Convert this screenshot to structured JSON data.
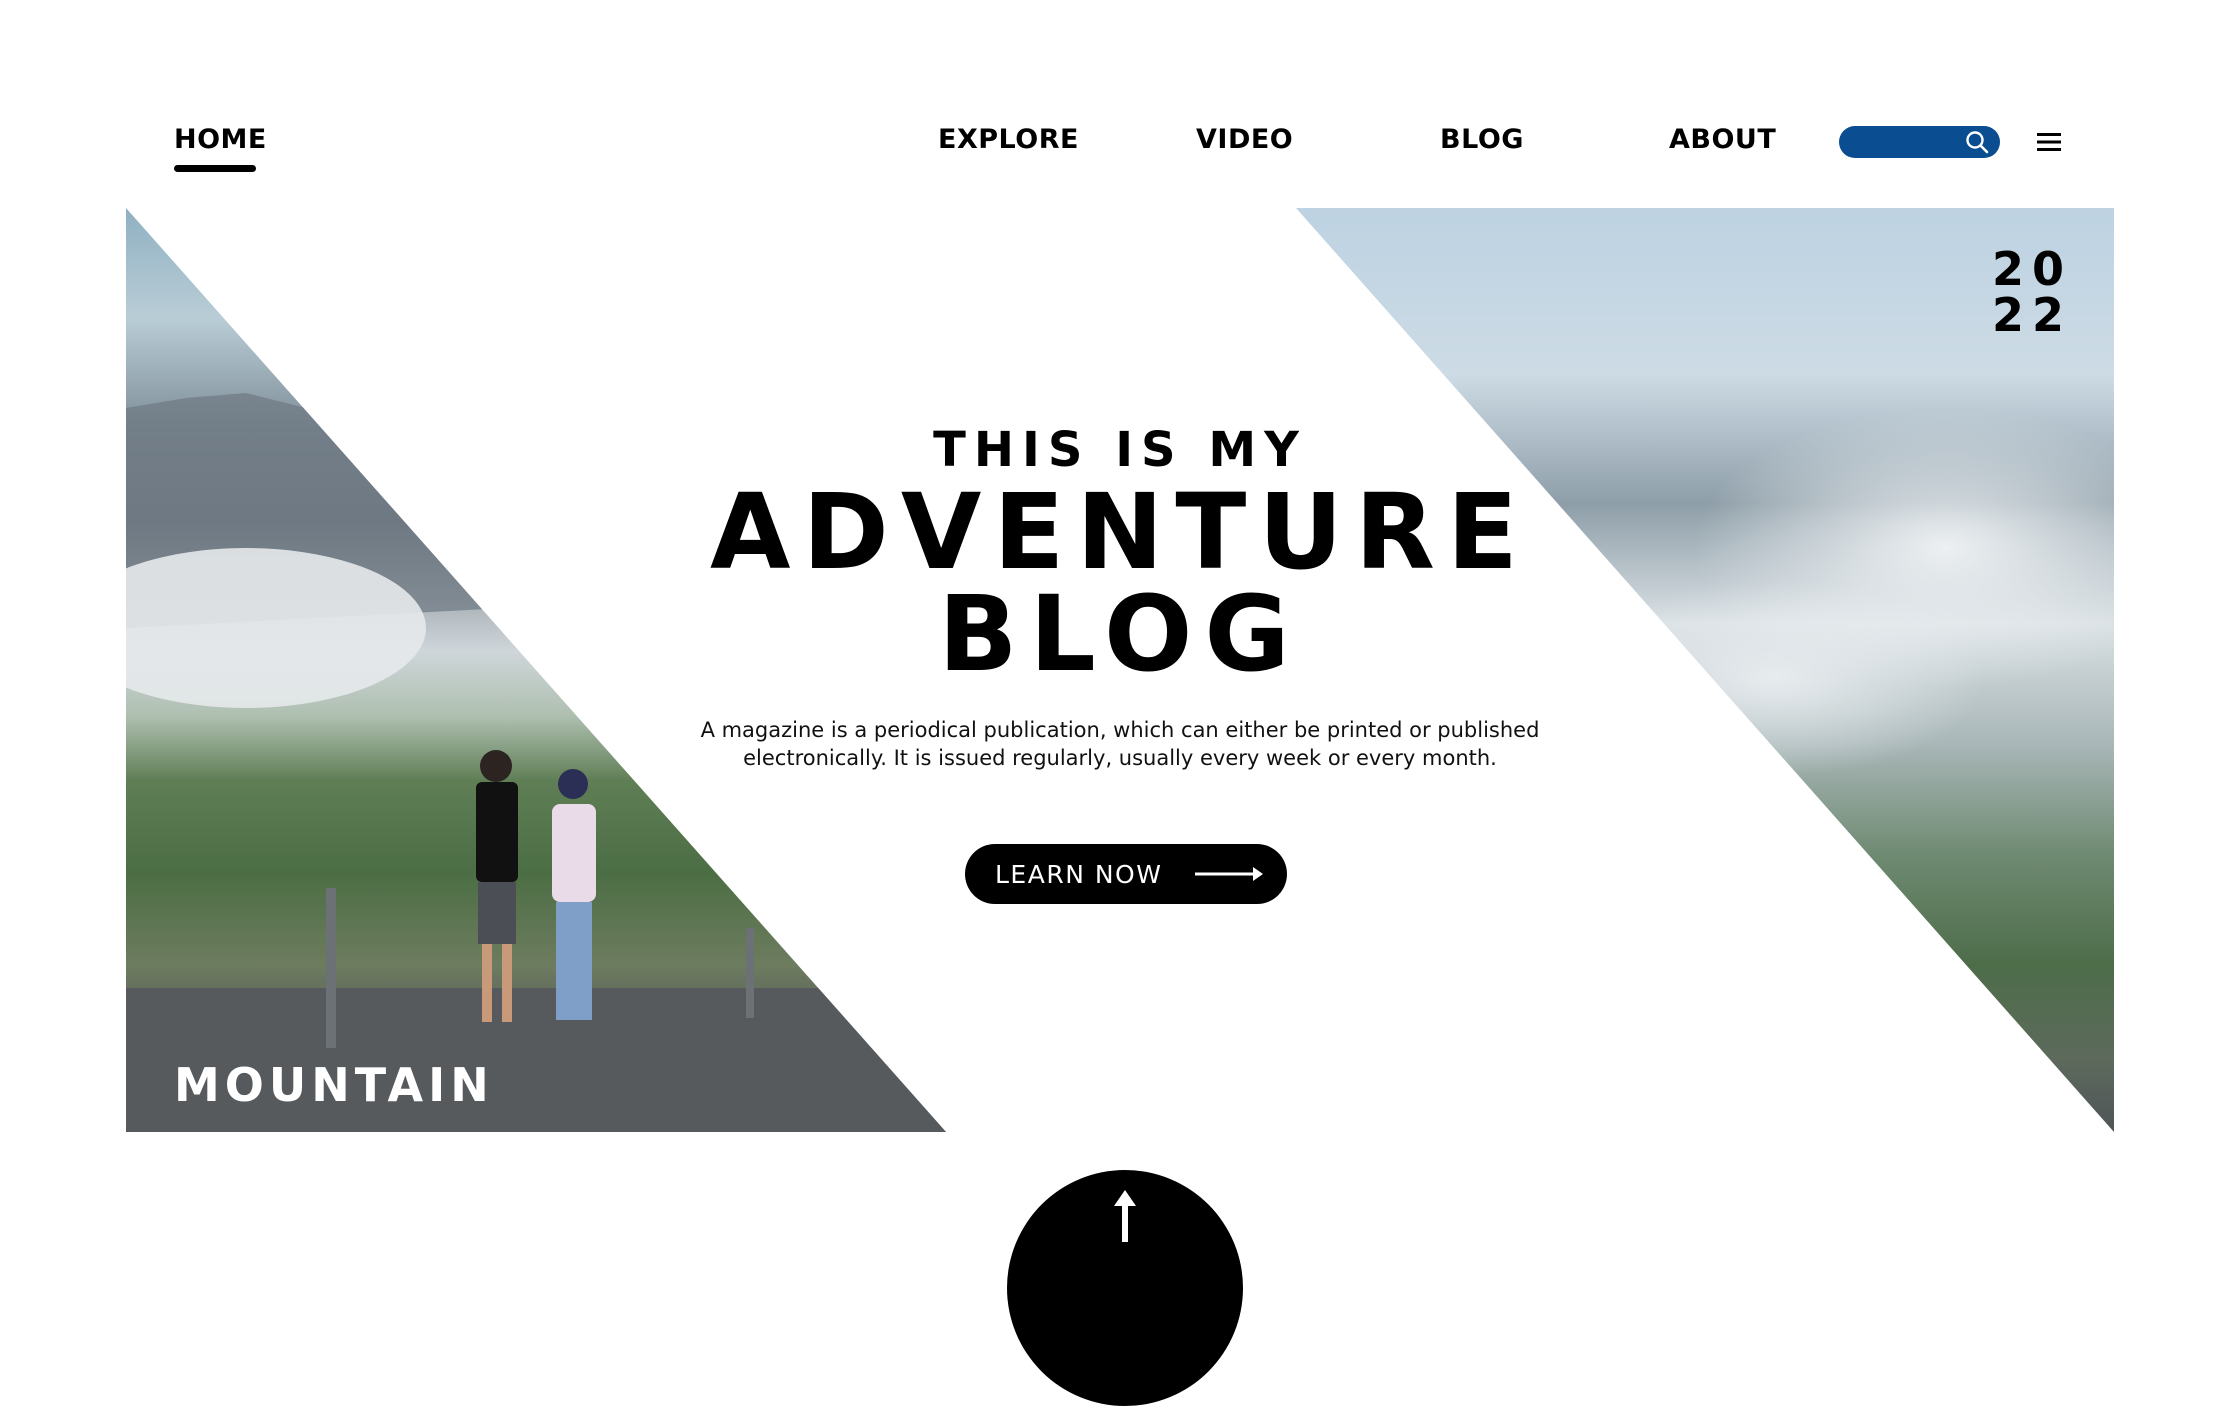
{
  "nav": {
    "items": [
      {
        "label": "HOME",
        "active": true
      },
      {
        "label": "EXPLORE"
      },
      {
        "label": "VIDEO"
      },
      {
        "label": "BLOG"
      },
      {
        "label": "ABOUT"
      }
    ],
    "search": {
      "value": "",
      "icon": "search-icon",
      "color": "#0a4d91"
    },
    "menu_icon": "hamburger-menu-icon"
  },
  "hero": {
    "year_line1": "20",
    "year_line2": "22",
    "kicker": "THIS IS MY",
    "title_line1": "ADVENTURE",
    "title_line2": "BLOG",
    "description": "A magazine is a periodical publication, which can either be printed or published electronically. It is issued regularly, usually every week or every month.",
    "cta_label": "LEARN NOW",
    "cta_icon": "arrow-right-icon",
    "photo_label": "MOUNTAIN"
  },
  "scroll_top": {
    "icon": "arrow-up-icon"
  }
}
